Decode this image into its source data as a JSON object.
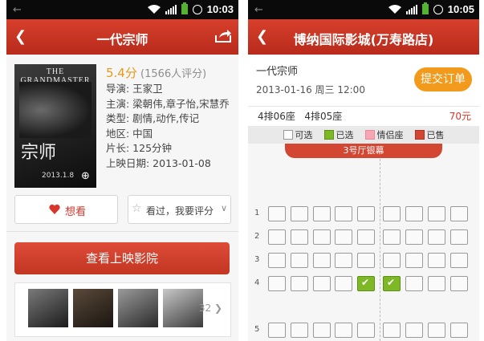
{
  "status_bar": {
    "left_time": "10:03",
    "right_time": "10:05"
  },
  "movie_page": {
    "title": "一代宗师",
    "poster_title": "THE GRANDMASTER",
    "poster_date": "2013.1.8",
    "score": "5.4分",
    "rating_count": "(1566人评分)",
    "info": [
      "导演: 王家卫",
      "主演: 梁朝伟,章子怡,宋慧乔",
      "类型: 剧情,动作,传记",
      "地区: 中国",
      "片长: 125分钟",
      "上映日期: 2013-01-08"
    ],
    "want_label": "想看",
    "seen_label": "看过，我要评分",
    "cinema_button": "查看上映影院",
    "stills_count": "32"
  },
  "seat_page": {
    "title": "博纳国际影城(万寿路店)",
    "movie_title": "一代宗师",
    "showtime": "2013-01-16 周三 12:00",
    "submit_label": "提交订单",
    "selected_seats": "4排06座   4排05座",
    "price": "70元",
    "legend": {
      "available": "可选",
      "selected": "已选",
      "couple": "情侣座",
      "sold": "已售"
    },
    "screen_label": "3号厅银幕",
    "rows": [
      {
        "label": "1",
        "selected": []
      },
      {
        "label": "2",
        "selected": []
      },
      {
        "label": "3",
        "selected": []
      },
      {
        "label": "4",
        "selected": [
          4,
          5
        ]
      },
      {
        "label": "5",
        "selected": []
      }
    ]
  },
  "colors": {
    "brand_red": "#c8321f",
    "orange": "#f29a1c",
    "selected_green": "#7fb827",
    "couple_pink": "#f7a6b4",
    "sold_red": "#d24632"
  },
  "icons": [
    "back-arrow-icon",
    "wifi-icon",
    "signal-icon",
    "battery-icon",
    "alarm-icon",
    "share-icon",
    "zoom-icon",
    "heart-icon",
    "star-icon",
    "chevron-right-icon"
  ]
}
